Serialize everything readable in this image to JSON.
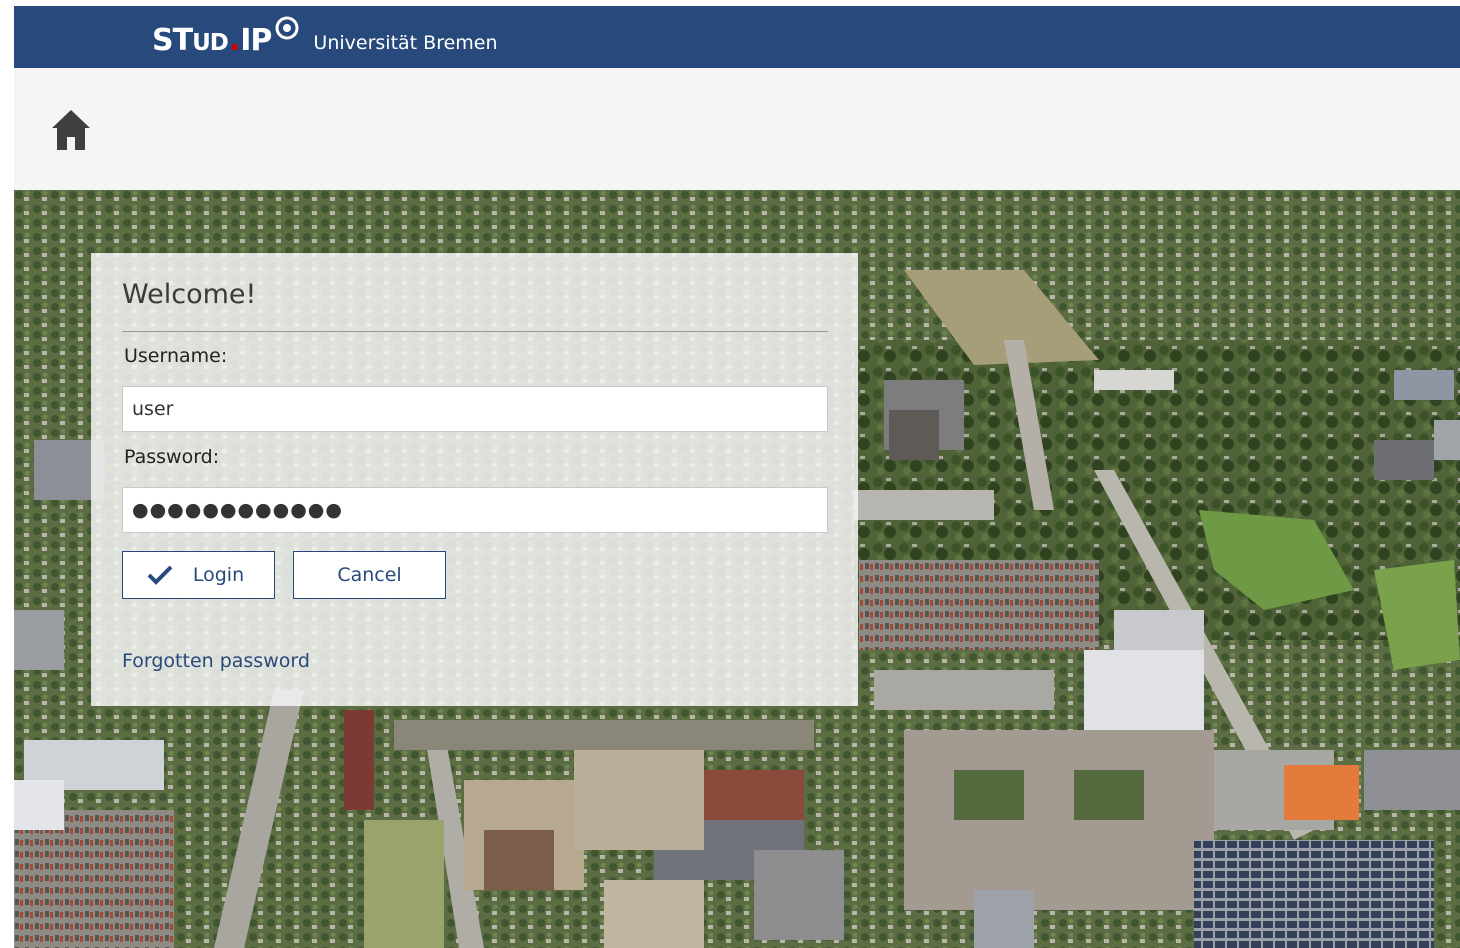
{
  "header": {
    "logo": {
      "text_st": "ST",
      "text_ud": "UD",
      "dot": ".",
      "text_ip": "IP"
    },
    "university": "Universität Bremen"
  },
  "nav": {
    "home_icon": "home-icon"
  },
  "login": {
    "title": "Welcome!",
    "username_label": "Username:",
    "username_value": "user",
    "password_label": "Password:",
    "password_value": "●●●●●●●●●●●●",
    "login_button": "Login",
    "cancel_button": "Cancel",
    "forgot_link": "Forgotten password"
  },
  "colors": {
    "brand": "#28497c",
    "nav_bg": "#f5f5f5",
    "logo_dot": "#d60000"
  }
}
